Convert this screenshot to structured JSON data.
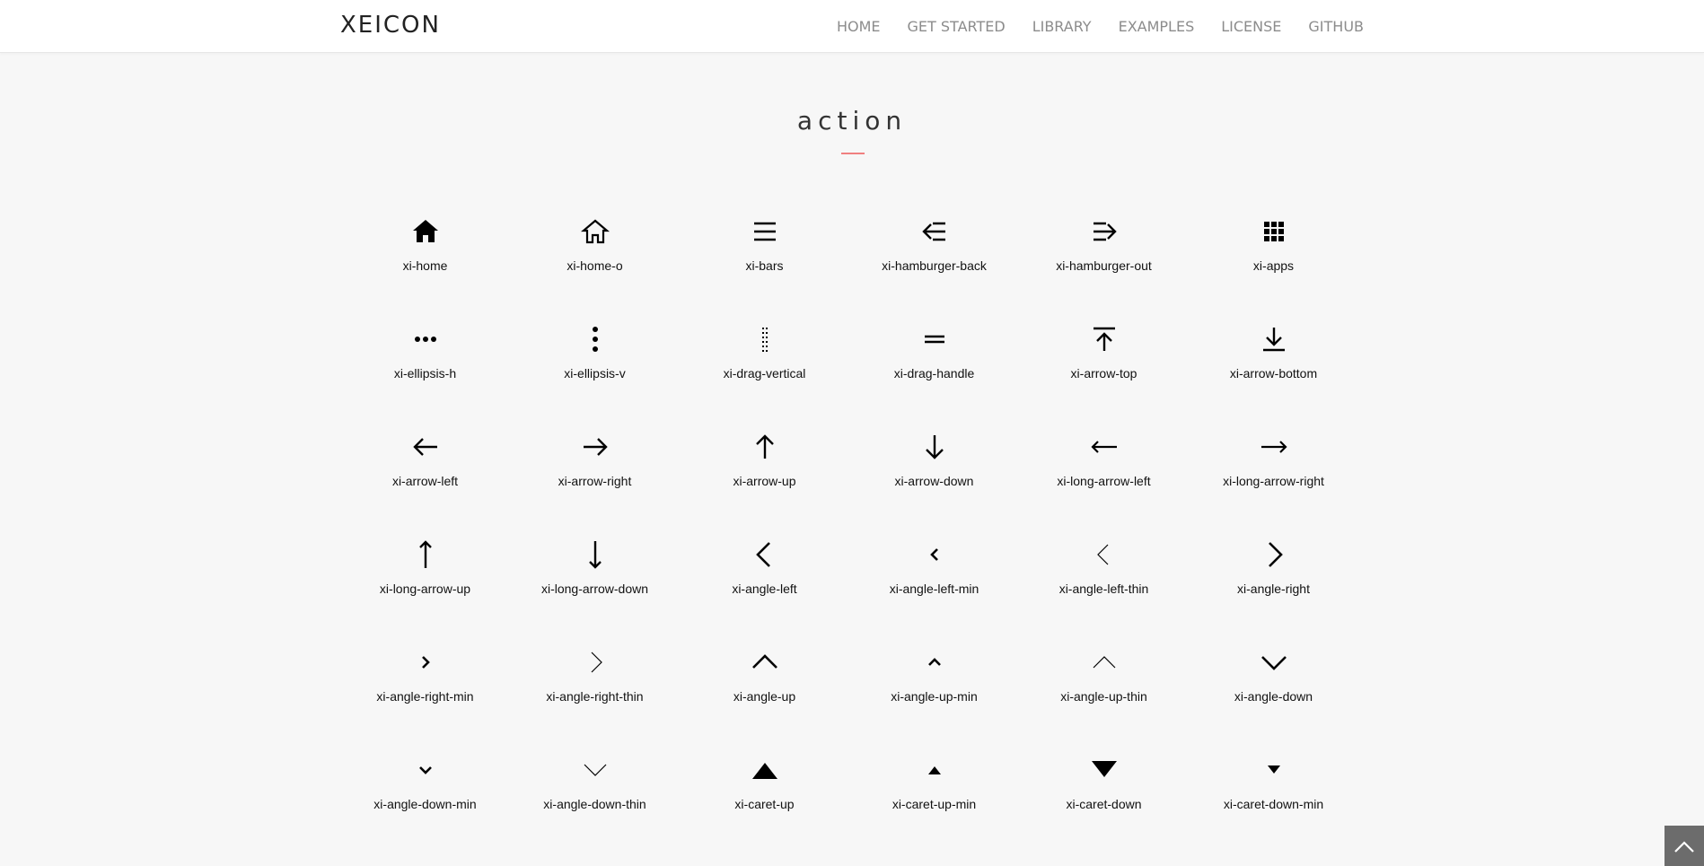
{
  "header": {
    "logo": "XEICON",
    "nav": [
      "HOME",
      "GET STARTED",
      "LIBRARY",
      "EXAMPLES",
      "LICENSE",
      "GITHUB"
    ]
  },
  "section": {
    "title": "action"
  },
  "icons": [
    {
      "name": "xi-home",
      "icon": "home-icon"
    },
    {
      "name": "xi-home-o",
      "icon": "home-outline-icon"
    },
    {
      "name": "xi-bars",
      "icon": "bars-icon"
    },
    {
      "name": "xi-hamburger-back",
      "icon": "hamburger-back-icon"
    },
    {
      "name": "xi-hamburger-out",
      "icon": "hamburger-out-icon"
    },
    {
      "name": "xi-apps",
      "icon": "apps-icon"
    },
    {
      "name": "xi-ellipsis-h",
      "icon": "ellipsis-h-icon"
    },
    {
      "name": "xi-ellipsis-v",
      "icon": "ellipsis-v-icon"
    },
    {
      "name": "xi-drag-vertical",
      "icon": "drag-vertical-icon"
    },
    {
      "name": "xi-drag-handle",
      "icon": "drag-handle-icon"
    },
    {
      "name": "xi-arrow-top",
      "icon": "arrow-top-icon"
    },
    {
      "name": "xi-arrow-bottom",
      "icon": "arrow-bottom-icon"
    },
    {
      "name": "xi-arrow-left",
      "icon": "arrow-left-icon"
    },
    {
      "name": "xi-arrow-right",
      "icon": "arrow-right-icon"
    },
    {
      "name": "xi-arrow-up",
      "icon": "arrow-up-icon"
    },
    {
      "name": "xi-arrow-down",
      "icon": "arrow-down-icon"
    },
    {
      "name": "xi-long-arrow-left",
      "icon": "long-arrow-left-icon"
    },
    {
      "name": "xi-long-arrow-right",
      "icon": "long-arrow-right-icon"
    },
    {
      "name": "xi-long-arrow-up",
      "icon": "long-arrow-up-icon"
    },
    {
      "name": "xi-long-arrow-down",
      "icon": "long-arrow-down-icon"
    },
    {
      "name": "xi-angle-left",
      "icon": "angle-left-icon"
    },
    {
      "name": "xi-angle-left-min",
      "icon": "angle-left-min-icon"
    },
    {
      "name": "xi-angle-left-thin",
      "icon": "angle-left-thin-icon"
    },
    {
      "name": "xi-angle-right",
      "icon": "angle-right-icon"
    },
    {
      "name": "xi-angle-right-min",
      "icon": "angle-right-min-icon"
    },
    {
      "name": "xi-angle-right-thin",
      "icon": "angle-right-thin-icon"
    },
    {
      "name": "xi-angle-up",
      "icon": "angle-up-icon"
    },
    {
      "name": "xi-angle-up-min",
      "icon": "angle-up-min-icon"
    },
    {
      "name": "xi-angle-up-thin",
      "icon": "angle-up-thin-icon"
    },
    {
      "name": "xi-angle-down",
      "icon": "angle-down-icon"
    },
    {
      "name": "xi-angle-down-min",
      "icon": "angle-down-min-icon"
    },
    {
      "name": "xi-angle-down-thin",
      "icon": "angle-down-thin-icon"
    },
    {
      "name": "xi-caret-up",
      "icon": "caret-up-icon"
    },
    {
      "name": "xi-caret-up-min",
      "icon": "caret-up-min-icon"
    },
    {
      "name": "xi-caret-down",
      "icon": "caret-down-icon"
    },
    {
      "name": "xi-caret-down-min",
      "icon": "caret-down-min-icon"
    }
  ],
  "scroll_top": {
    "icon": "chevron-up-icon"
  }
}
